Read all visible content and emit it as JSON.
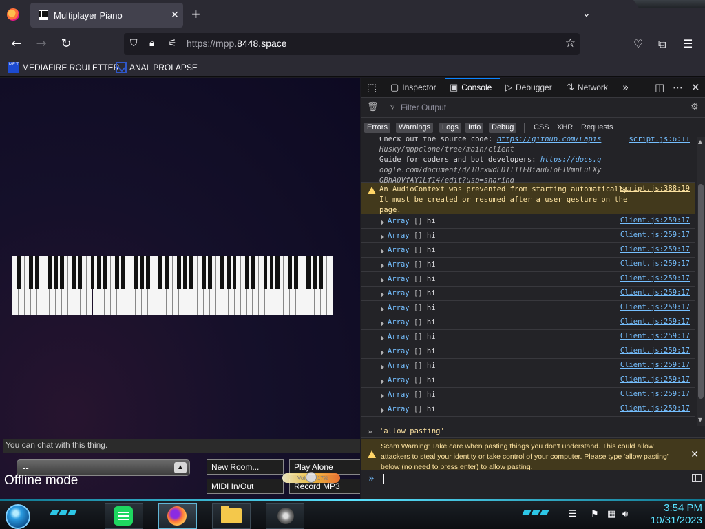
{
  "browser": {
    "tab_title": "Multiplayer Piano",
    "tab_close": "✕",
    "new_tab": "+",
    "tab_list": "⌄",
    "url_prefix": "https://mpp.",
    "url_domain": "8448.space",
    "back": "←",
    "forward": "→",
    "reload": "↻",
    "star": "☆"
  },
  "bookmarks": [
    {
      "label": "MEDIAFIRE ROULETTER",
      "icon": "mediafire-icon",
      "icon_text": "MF T"
    },
    {
      "label": "ANAL PROLAPSE",
      "icon": "bookmark-site-icon"
    }
  ],
  "page": {
    "chat_placeholder": "You can chat with this thing.",
    "room_select_value": "--",
    "room_select_arrow": "▲",
    "status": "Offline mode",
    "buttons": {
      "new_room": "New Room...",
      "play_alone": "Play Alone",
      "midi": "MIDI In/Out",
      "record": "Record MP3"
    },
    "volume_label": "Volume 17%",
    "volume_level": 0.17
  },
  "devtools": {
    "tabs": [
      {
        "label": "Inspector",
        "icon": "inspector-icon"
      },
      {
        "label": "Console",
        "icon": "console-icon",
        "active": true
      },
      {
        "label": "Debugger",
        "icon": "debugger-icon"
      },
      {
        "label": "Network",
        "icon": "network-icon"
      }
    ],
    "more_tabs": "»",
    "filter_placeholder": "Filter Output",
    "levels": [
      "Errors",
      "Warnings",
      "Logs",
      "Info",
      "Debug"
    ],
    "categories": [
      "CSS",
      "XHR",
      "Requests"
    ],
    "messages": {
      "info_lines": [
        "Check out the source code: ",
        "Husky/mppclone/tree/main/client",
        "Guide for coders and bot developers: ",
        "oogle.com/document/d/1OrxwdLD1l1TE8iau6ToETVmnLuLXy",
        "GBhA0VfAY1Lf14/edit?usp=sharing"
      ],
      "info_link_1": "https://github.com/Lapis",
      "info_link_2": "https://docs.g",
      "info_source": "script.js:6:11",
      "warning": "An AudioContext was prevented from starting automatically.\nIt must be created or resumed after a user gesture on the\npage.",
      "warning_source": "script.js:388:19",
      "array_label": "Array",
      "array_brackets": "[]",
      "array_value": "hi",
      "array_source": "Client.js:259:17",
      "array_count": 14
    },
    "echo": "'allow pasting'",
    "scam_warning": "Scam Warning: Take care when pasting things you don't understand. This could allow attackers to steal your identity or take control of your computer. Please type 'allow pasting' below (no need to press enter) to allow pasting.",
    "prompt": "»"
  },
  "taskbar": {
    "time": "3:54 PM",
    "date": "10/31/2023"
  },
  "colors": {
    "accent": "#0a84ff",
    "link": "#75bfff",
    "warning_bg": "#42391c",
    "warning_text": "#fce2a1",
    "taskbar_accent": "#5be2ff"
  }
}
